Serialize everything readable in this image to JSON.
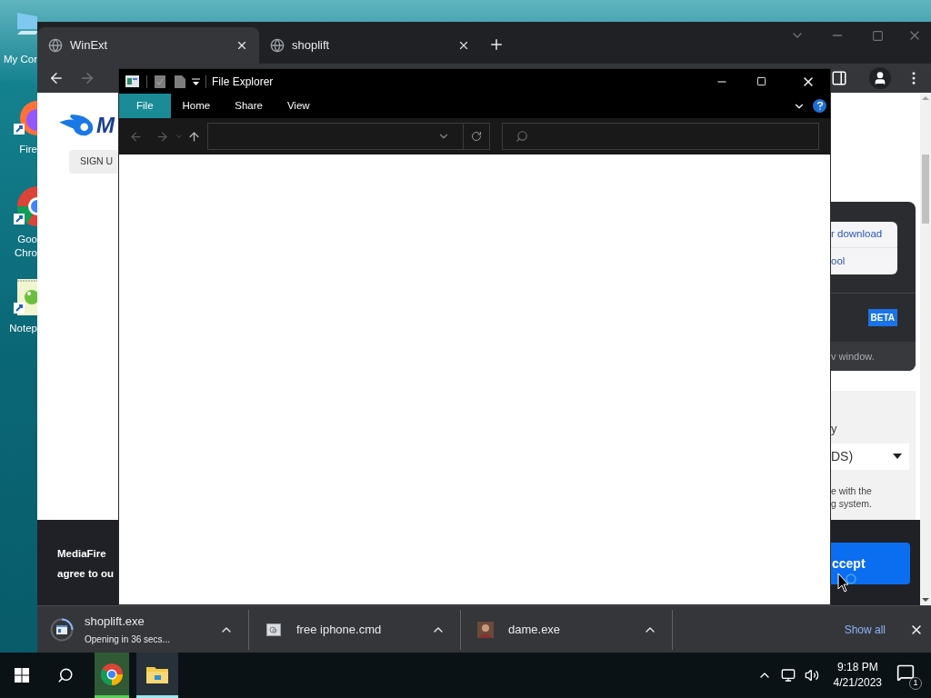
{
  "desktop_icons": [
    {
      "kind": "computer",
      "lines": [
        "My Cor"
      ]
    },
    {
      "kind": "firefox",
      "lines": [
        "Fire"
      ]
    },
    {
      "kind": "chrome",
      "lines": [
        "Goo",
        "Chro"
      ]
    },
    {
      "kind": "notepad",
      "lines": [
        "Notep"
      ]
    }
  ],
  "browser": {
    "tabs": [
      {
        "title": "WinExt",
        "selected": true
      },
      {
        "title": "shoplift",
        "selected": false
      }
    ],
    "page": {
      "logo_text": "M",
      "sign_up": "SIGN U",
      "card_links": [
        "r download",
        "ool"
      ],
      "badge": "BETA",
      "card_note": "v window.",
      "panel_label": "y",
      "select_value": "DS)",
      "panel_note": [
        "e with the",
        "g system."
      ],
      "cookie_text": [
        "MediaFire",
        "agree to ou"
      ],
      "accept": "ccept"
    },
    "downloads": [
      {
        "kind": "app",
        "name": "shoplift.exe",
        "status": "Opening in 36 secs..."
      },
      {
        "kind": "script",
        "name": "free iphone.cmd"
      },
      {
        "kind": "portrait",
        "name": "dame.exe"
      }
    ],
    "show_all": "Show all"
  },
  "explorer": {
    "title": "File Explorer",
    "ribbon_tabs": [
      {
        "label": "File",
        "selected": true
      },
      {
        "label": "Home",
        "selected": false
      },
      {
        "label": "Share",
        "selected": false
      },
      {
        "label": "View",
        "selected": false
      }
    ]
  },
  "taskbar": {
    "apps": [
      {
        "kind": "chrome"
      },
      {
        "kind": "explorer"
      }
    ],
    "time": "9:18 PM",
    "date": "4/21/2023",
    "notifications": "1"
  }
}
